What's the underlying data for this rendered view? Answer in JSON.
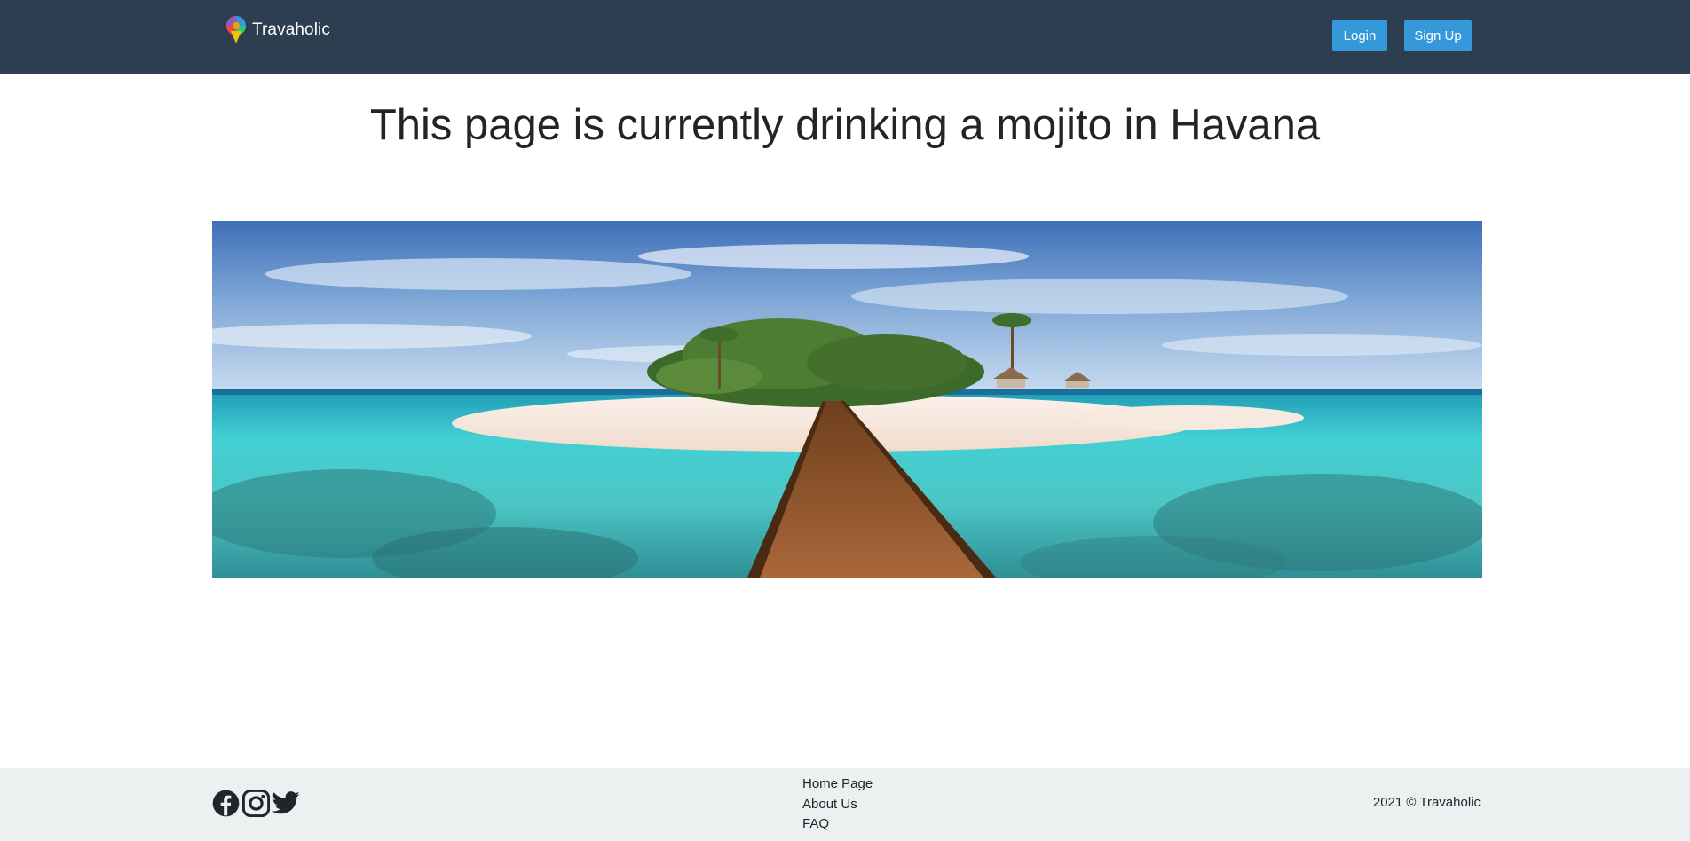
{
  "navbar": {
    "brand_name": "Travaholic",
    "brand_icon": "map-pin-globe-icon",
    "login_label": "Login",
    "signup_label": "Sign Up"
  },
  "main": {
    "title": "This page is currently drinking a mojito in Havana",
    "hero_image": "tropical-island-boardwalk-photo"
  },
  "footer": {
    "social_icons": [
      "facebook-icon",
      "instagram-icon",
      "twitter-icon"
    ],
    "links": [
      "Home Page",
      "About Us",
      "FAQ"
    ],
    "copyright": "2021 © Travaholic"
  },
  "colors": {
    "navbar_bg": "#2c3e50",
    "button_bg": "#3498db",
    "footer_bg": "#ecf0f1",
    "text": "#212529"
  }
}
